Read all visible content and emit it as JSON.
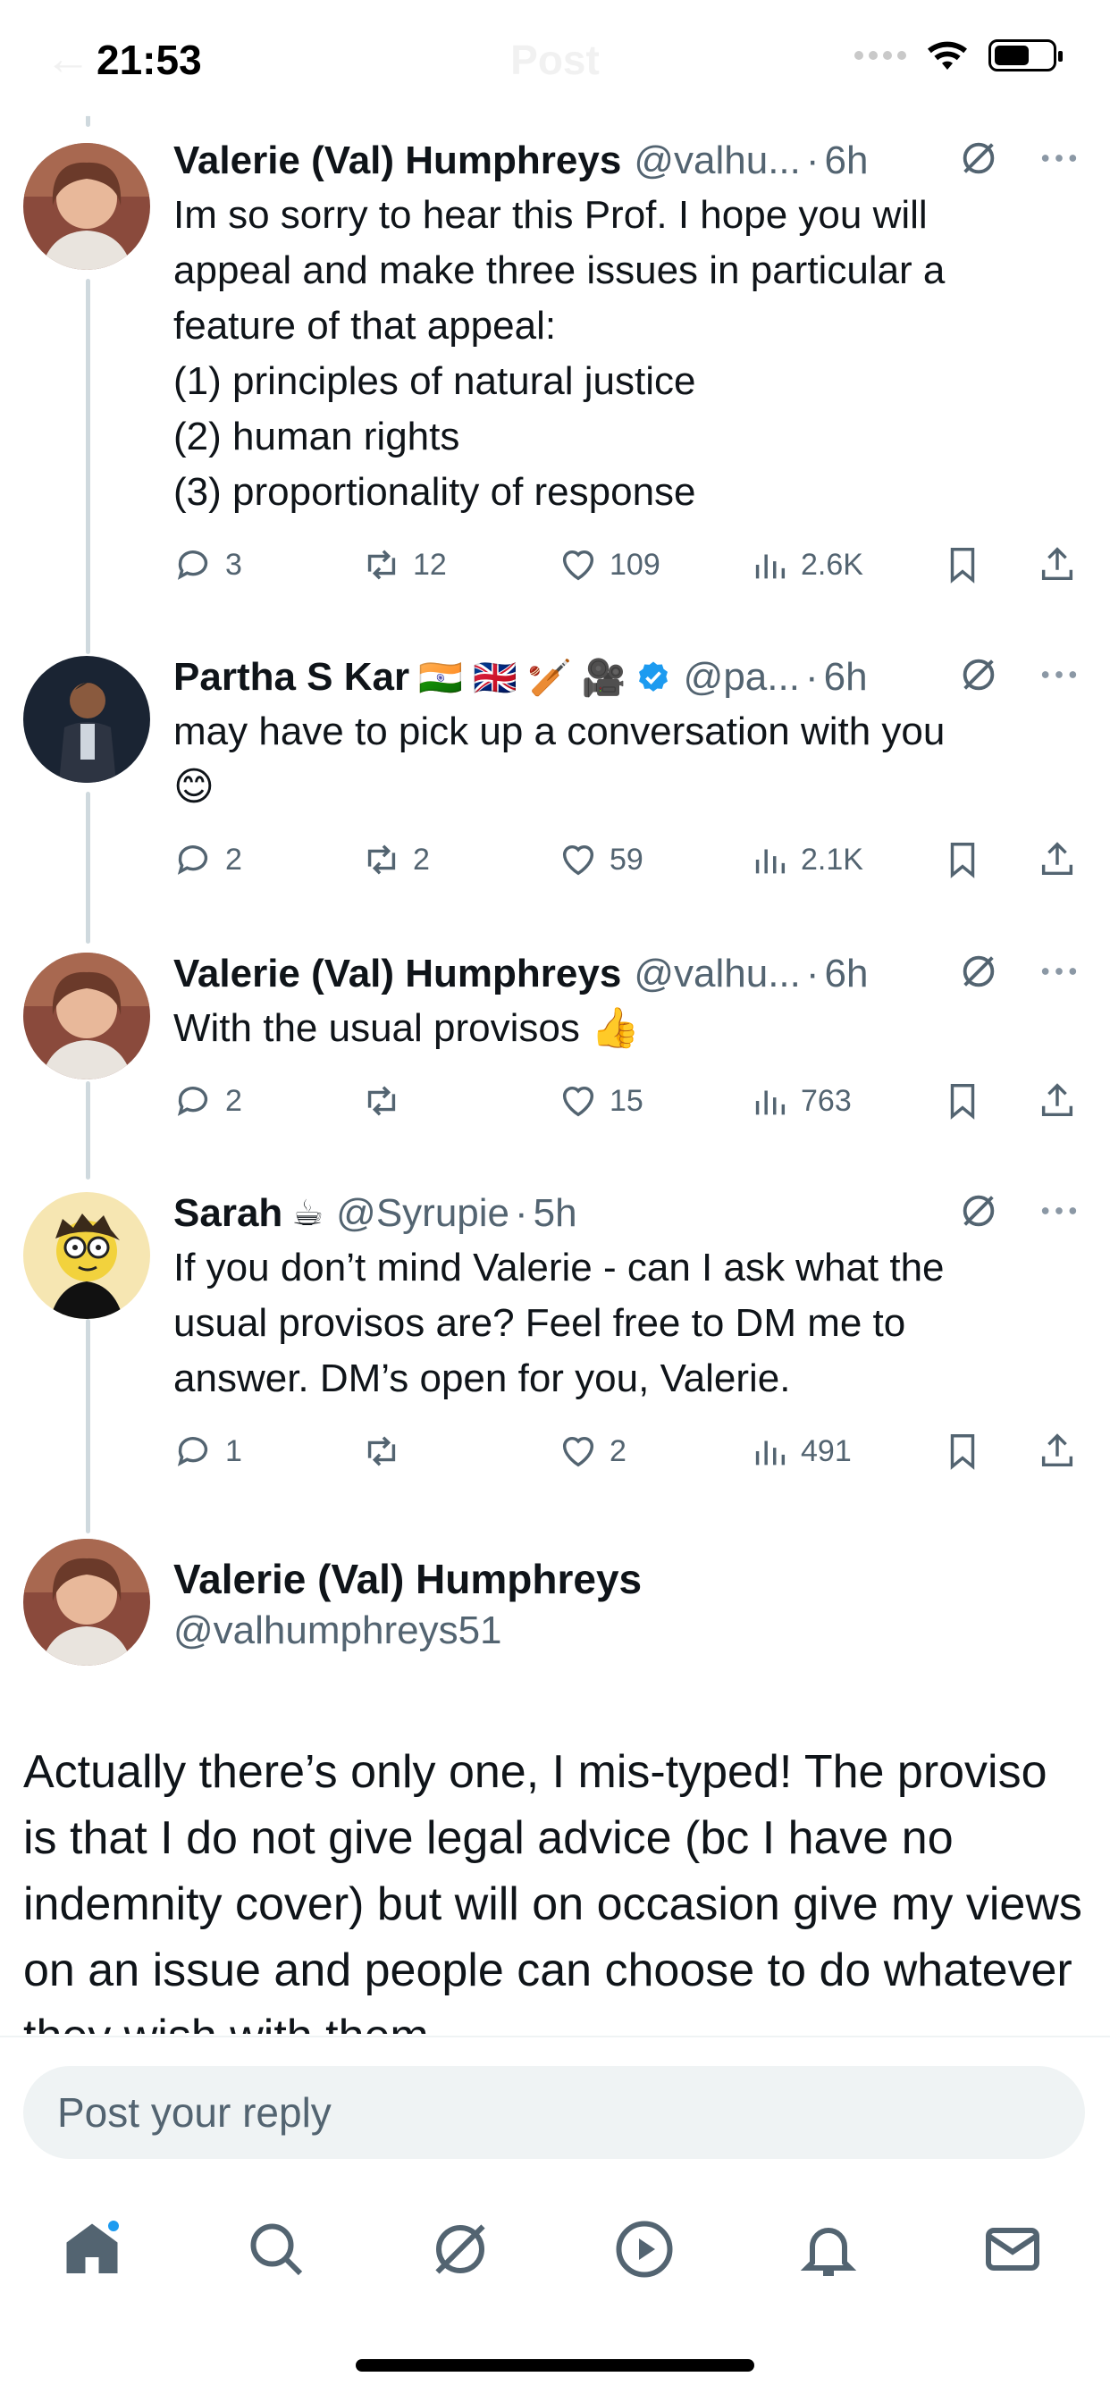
{
  "status_bar": {
    "time": "21:53",
    "ghost_title": "Post"
  },
  "replies": [
    {
      "name": "Valerie (Val) Humphreys",
      "handle": "@valhu...",
      "time": "6h",
      "lines": [
        "Im so sorry to hear this Prof. I hope you will",
        "appeal and make three issues in particular a",
        "feature of that appeal:",
        "(1) principles of natural justice",
        "(2) human rights",
        "(3) proportionality of response"
      ],
      "replies": "3",
      "reposts": "12",
      "likes": "109",
      "views": "2.6K"
    },
    {
      "name": "Partha S Kar",
      "badges": "🇮🇳 🇬🇧 🏏 🎥",
      "handle": "@pa...",
      "time": "6h",
      "lines": [
        "may have to pick up a conversation with you",
        "😊"
      ],
      "replies": "2",
      "reposts": "2",
      "likes": "59",
      "views": "2.1K"
    },
    {
      "name": "Valerie (Val) Humphreys",
      "handle": "@valhu...",
      "time": "6h",
      "lines": [
        "With the usual provisos 👍"
      ],
      "replies": "2",
      "reposts": "",
      "likes": "15",
      "views": "763"
    },
    {
      "name": "Sarah",
      "badges": "☕",
      "handle": "@Syrupie",
      "time": "5h",
      "lines": [
        "If you don’t mind Valerie - can I ask what the",
        "usual provisos are? Feel free to DM me to",
        "answer. DM’s open for you, Valerie."
      ],
      "replies": "1",
      "reposts": "",
      "likes": "2",
      "views": "491"
    }
  ],
  "main_post": {
    "name": "Valerie (Val) Humphreys",
    "handle": "@valhumphreys51",
    "text": "Actually there’s only one, I mis-typed! The proviso is that I do not give legal advice (bc I have no indemnity cover) but will on occasion give my views on an issue and people can choose to do whatever they wish with them."
  },
  "reply_bar": {
    "placeholder": "Post your reply"
  },
  "tabs": [
    "home-icon",
    "search-icon",
    "grok-icon",
    "video-icon",
    "bell-icon",
    "mail-icon"
  ],
  "colors": {
    "accent": "#1d9bf0",
    "secondary_text": "#536471",
    "thread_line": "#cfd9de"
  }
}
